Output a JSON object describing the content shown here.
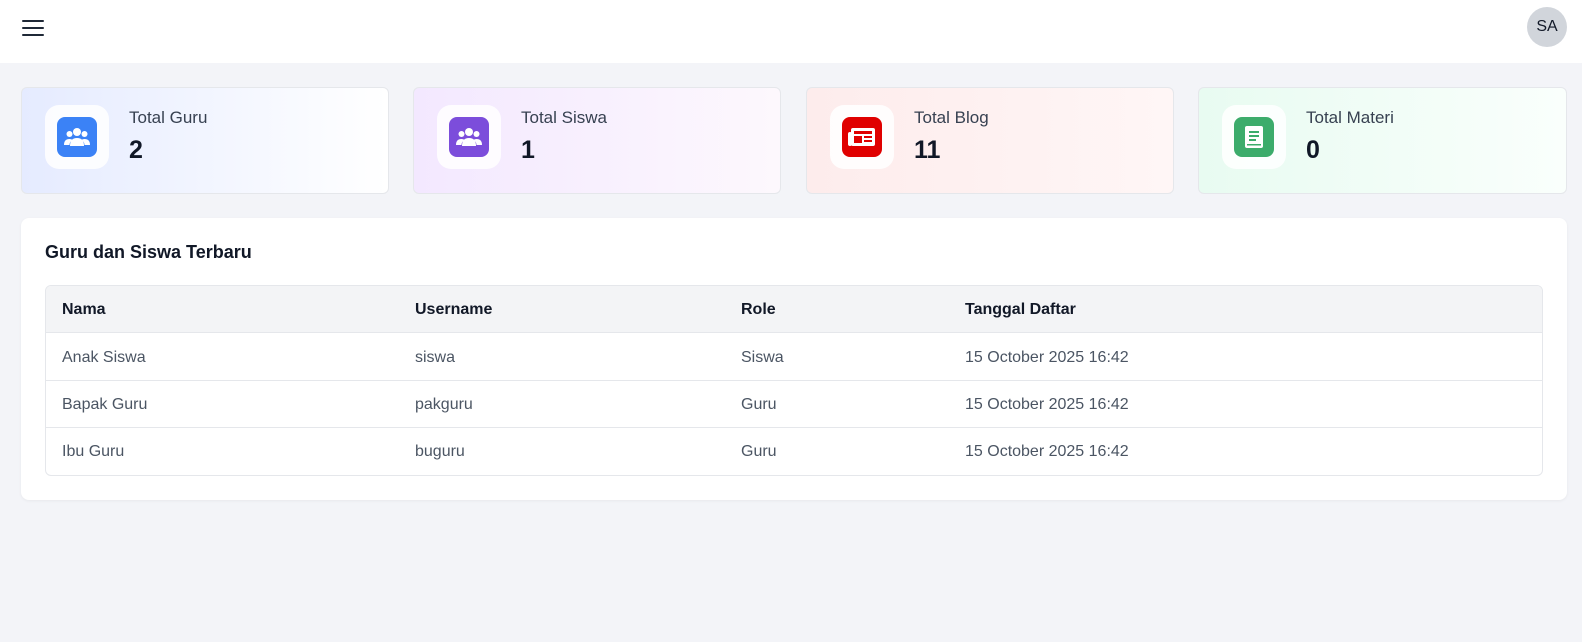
{
  "header": {
    "avatar_initials": "SA"
  },
  "stats": [
    {
      "label": "Total Guru",
      "value": "2",
      "icon": "users-icon",
      "accent": "#3b82f6",
      "bg_from": "#e5ebff",
      "bg_to": "#ffffff"
    },
    {
      "label": "Total Siswa",
      "value": "1",
      "icon": "users-icon",
      "accent": "#7c4ddb",
      "bg_from": "#f3e8ff",
      "bg_to": "#fdf8fd"
    },
    {
      "label": "Total Blog",
      "value": "11",
      "icon": "newspaper-icon",
      "accent": "#e00000",
      "bg_from": "#fdecec",
      "bg_to": "#fff6f6"
    },
    {
      "label": "Total Materi",
      "value": "0",
      "icon": "book-icon",
      "accent": "#3cac6b",
      "bg_from": "#e8fbf1",
      "bg_to": "#fafffc"
    }
  ],
  "recent": {
    "title": "Guru dan Siswa Terbaru",
    "columns": [
      "Nama",
      "Username",
      "Role",
      "Tanggal Daftar"
    ],
    "rows": [
      [
        "Anak Siswa",
        "siswa",
        "Siswa",
        "15 October 2025 16:42"
      ],
      [
        "Bapak Guru",
        "pakguru",
        "Guru",
        "15 October 2025 16:42"
      ],
      [
        "Ibu Guru",
        "buguru",
        "Guru",
        "15 October 2025 16:42"
      ]
    ]
  }
}
